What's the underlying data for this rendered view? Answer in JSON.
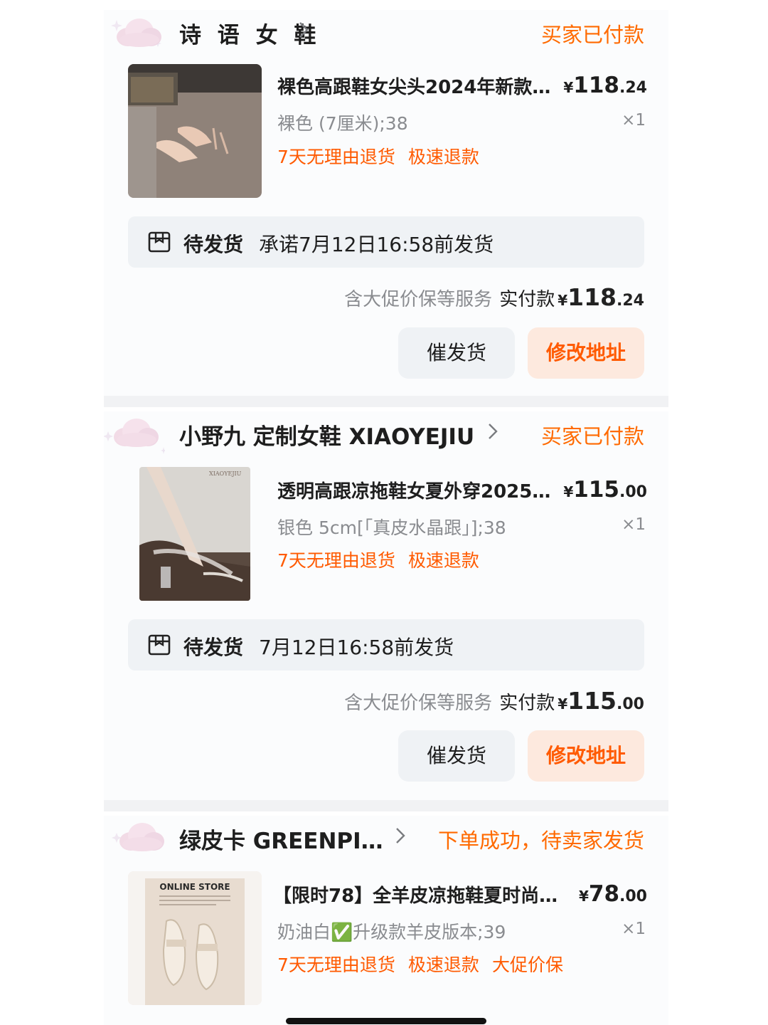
{
  "orders": [
    {
      "shop": "诗 语 女 鞋",
      "status": "买家已付款",
      "product_title": "裸色高跟鞋女尖头2024年新款…",
      "price_int": "118",
      "price_dec": ".24",
      "sku": "裸色 (7厘米);38",
      "qty": "×1",
      "tags": [
        "7天无理由退货",
        "极速退款"
      ],
      "ship_label": "待发货",
      "ship_promise": "承诺7月12日16:58前发货",
      "service_text": "含大促价保等服务",
      "paid_label": "实付款",
      "total_int": "118",
      "total_dec": ".24",
      "btn_urge": "催发货",
      "btn_addr": "修改地址"
    },
    {
      "shop": "小野九 定制女鞋 XIAOYEJIU",
      "status": "买家已付款",
      "product_title": "透明高跟凉拖鞋女夏外穿2025…",
      "price_int": "115",
      "price_dec": ".00",
      "sku": "银色 5cm[「真皮水晶跟」];38",
      "qty": "×1",
      "tags": [
        "7天无理由退货",
        "极速退款"
      ],
      "thumb_watermark": "XIAOYEJIU",
      "ship_label": "待发货",
      "ship_promise": "7月12日16:58前发货",
      "service_text": "含大促价保等服务",
      "paid_label": "实付款",
      "total_int": "115",
      "total_dec": ".00",
      "btn_urge": "催发货",
      "btn_addr": "修改地址"
    },
    {
      "shop": "绿皮卡 GREENPI…",
      "status": "下单成功，待卖家发货",
      "product_title": "【限时78】全羊皮凉拖鞋夏时尚…",
      "price_int": "78",
      "price_dec": ".00",
      "sku": "奶油白✅升级款羊皮版本;39",
      "qty": "×1",
      "tags": [
        "7天无理由退货",
        "极速退款",
        "大促价保"
      ],
      "thumb_caption": "ONLINE STORE"
    }
  ],
  "currency": "¥",
  "icons": {
    "decor": "cloud-sticker-icon",
    "chevron": "chevron-right-icon",
    "box": "package-box-icon",
    "check": "check-mark-icon"
  },
  "colors": {
    "accent": "#ff6a00",
    "tag": "#ff5a00",
    "secondary_bg": "#eff2f5",
    "primary_btn_bg": "#fde9de"
  }
}
